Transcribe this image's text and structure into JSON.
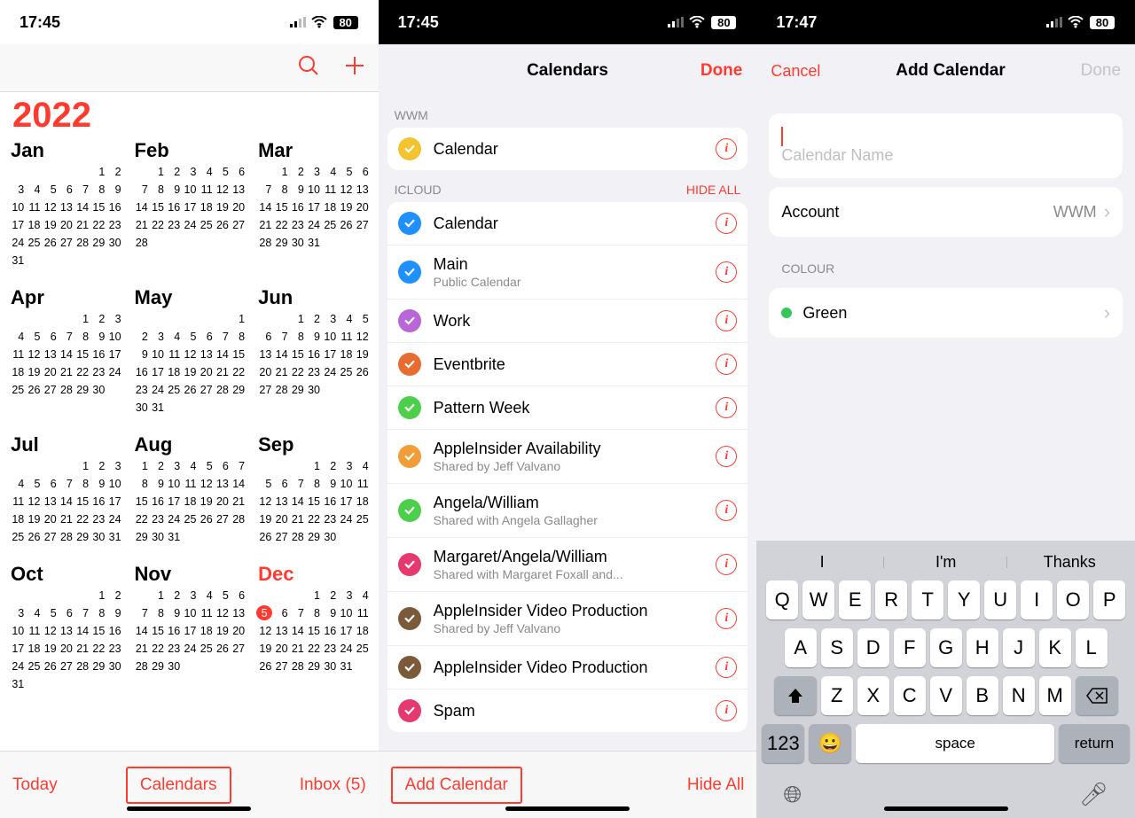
{
  "screen1": {
    "time": "17:45",
    "battery": "80",
    "year": "2022",
    "today_btn": "Today",
    "calendars_btn": "Calendars",
    "inbox_btn": "Inbox (5)",
    "months": [
      {
        "name": "Jan",
        "lead": 5,
        "days": 31
      },
      {
        "name": "Feb",
        "lead": 1,
        "days": 28
      },
      {
        "name": "Mar",
        "lead": 1,
        "days": 31
      },
      {
        "name": "Apr",
        "lead": 4,
        "days": 30
      },
      {
        "name": "May",
        "lead": 6,
        "days": 31
      },
      {
        "name": "Jun",
        "lead": 2,
        "days": 30
      },
      {
        "name": "Jul",
        "lead": 4,
        "days": 31
      },
      {
        "name": "Aug",
        "lead": 0,
        "days": 31
      },
      {
        "name": "Sep",
        "lead": 3,
        "days": 30
      },
      {
        "name": "Oct",
        "lead": 5,
        "days": 31
      },
      {
        "name": "Nov",
        "lead": 1,
        "days": 30
      },
      {
        "name": "Dec",
        "lead": 3,
        "days": 31,
        "current": true,
        "today": 5
      }
    ]
  },
  "screen2": {
    "time": "17:45",
    "battery": "80",
    "title": "Calendars",
    "done": "Done",
    "add_calendar": "Add Calendar",
    "hide_all_btn": "Hide All",
    "sections": [
      {
        "header": "WWM",
        "hide": "",
        "items": [
          {
            "name": "Calendar",
            "color": "#f4c430"
          }
        ]
      },
      {
        "header": "ICLOUD",
        "hide": "HIDE ALL",
        "items": [
          {
            "name": "Calendar",
            "color": "#1e90ff"
          },
          {
            "name": "Main",
            "sub": "Public Calendar",
            "color": "#1e90ff"
          },
          {
            "name": "Work",
            "color": "#b866d8"
          },
          {
            "name": "Eventbrite",
            "color": "#e86b2f"
          },
          {
            "name": "Pattern Week",
            "color": "#4cd04c"
          },
          {
            "name": "AppleInsider Availability",
            "sub": "Shared by Jeff Valvano",
            "color": "#f19d38"
          },
          {
            "name": "Angela/William",
            "sub": "Shared with Angela Gallagher",
            "color": "#4cd04c"
          },
          {
            "name": "Margaret/Angela/William",
            "sub": "Shared with Margaret Foxall and...",
            "color": "#e63970"
          },
          {
            "name": "AppleInsider Video Production",
            "sub": "Shared by Jeff Valvano",
            "color": "#7b5a3a"
          },
          {
            "name": "AppleInsider Video Production",
            "color": "#7b5a3a"
          },
          {
            "name": "Spam",
            "color": "#e63970"
          }
        ]
      }
    ]
  },
  "screen3": {
    "time": "17:47",
    "battery": "80",
    "cancel": "Cancel",
    "title": "Add Calendar",
    "done": "Done",
    "name_placeholder": "Calendar Name",
    "account_label": "Account",
    "account_value": "WWM",
    "colour_header": "COLOUR",
    "colour_value": "Green",
    "colour_hex": "#34c759",
    "keyboard": {
      "suggestions": [
        "I",
        "I'm",
        "Thanks"
      ],
      "row1": [
        "Q",
        "W",
        "E",
        "R",
        "T",
        "Y",
        "U",
        "I",
        "O",
        "P"
      ],
      "row2": [
        "A",
        "S",
        "D",
        "F",
        "G",
        "H",
        "J",
        "K",
        "L"
      ],
      "row3": [
        "Z",
        "X",
        "C",
        "V",
        "B",
        "N",
        "M"
      ],
      "space": "space",
      "return": "return",
      "num": "123"
    }
  }
}
